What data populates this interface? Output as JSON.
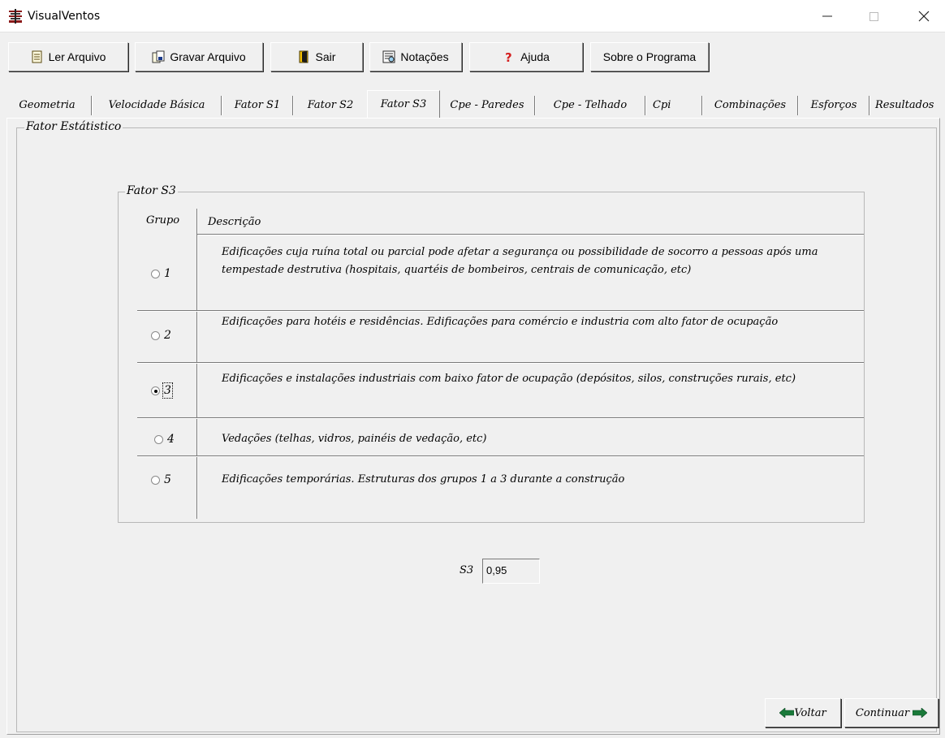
{
  "window": {
    "title": "VisualVentos"
  },
  "toolbar": {
    "buttons": [
      {
        "label": "Ler Arquivo",
        "icon": "file-open-icon"
      },
      {
        "label": "Gravar Arquivo",
        "icon": "file-save-icon"
      },
      {
        "label": "Sair",
        "icon": "exit-door-icon"
      },
      {
        "label": "Notações",
        "icon": "notations-icon"
      },
      {
        "label": "Ajuda",
        "icon": "help-question-icon"
      },
      {
        "label": "Sobre o Programa",
        "icon": ""
      }
    ]
  },
  "tabs": [
    {
      "label": "Geometria",
      "active": false
    },
    {
      "label": "Velocidade Básica",
      "active": false
    },
    {
      "label": "Fator S1",
      "active": false
    },
    {
      "label": "Fator S2",
      "active": false
    },
    {
      "label": "Fator S3",
      "active": true
    },
    {
      "label": "Cpe - Paredes",
      "active": false
    },
    {
      "label": "Cpe - Telhado",
      "active": false
    },
    {
      "label": "Cpi",
      "active": false
    },
    {
      "label": "Combinações",
      "active": false
    },
    {
      "label": "Esforços",
      "active": false
    },
    {
      "label": "Resultados",
      "active": false
    }
  ],
  "outer_group": {
    "legend": "Fator Estátistico"
  },
  "inner_group": {
    "legend": "Fator S3",
    "col_group": "Grupo",
    "col_desc": "Descrição",
    "rows": [
      {
        "group": "1",
        "selected": false,
        "description": "Edificações cuja ruína total ou parcial pode afetar a segurança ou possibilidade de socorro a pessoas após uma tempestade destrutiva (hospitais, quartéis de bombeiros, centrais de comunicação, etc)"
      },
      {
        "group": "2",
        "selected": false,
        "description": "Edificações para hotéis e residências. Edificações para comércio e industria com alto fator de ocupação"
      },
      {
        "group": "3",
        "selected": true,
        "description": "Edificações e instalações industriais com baixo fator de ocupação (depósitos, silos, construções rurais, etc)"
      },
      {
        "group": "4",
        "selected": false,
        "description": "Vedações (telhas, vidros, painéis de vedação, etc)"
      },
      {
        "group": "5",
        "selected": false,
        "description": "Edificações temporárias. Estruturas dos grupos 1 a 3 durante a construção"
      }
    ]
  },
  "s3": {
    "label": "S3",
    "value": "0,95"
  },
  "nav": {
    "back": "Voltar",
    "next": "Continuar"
  },
  "colors": {
    "arrow_green": "#1a7a3a",
    "arrow_dark": "#0a4a22"
  }
}
